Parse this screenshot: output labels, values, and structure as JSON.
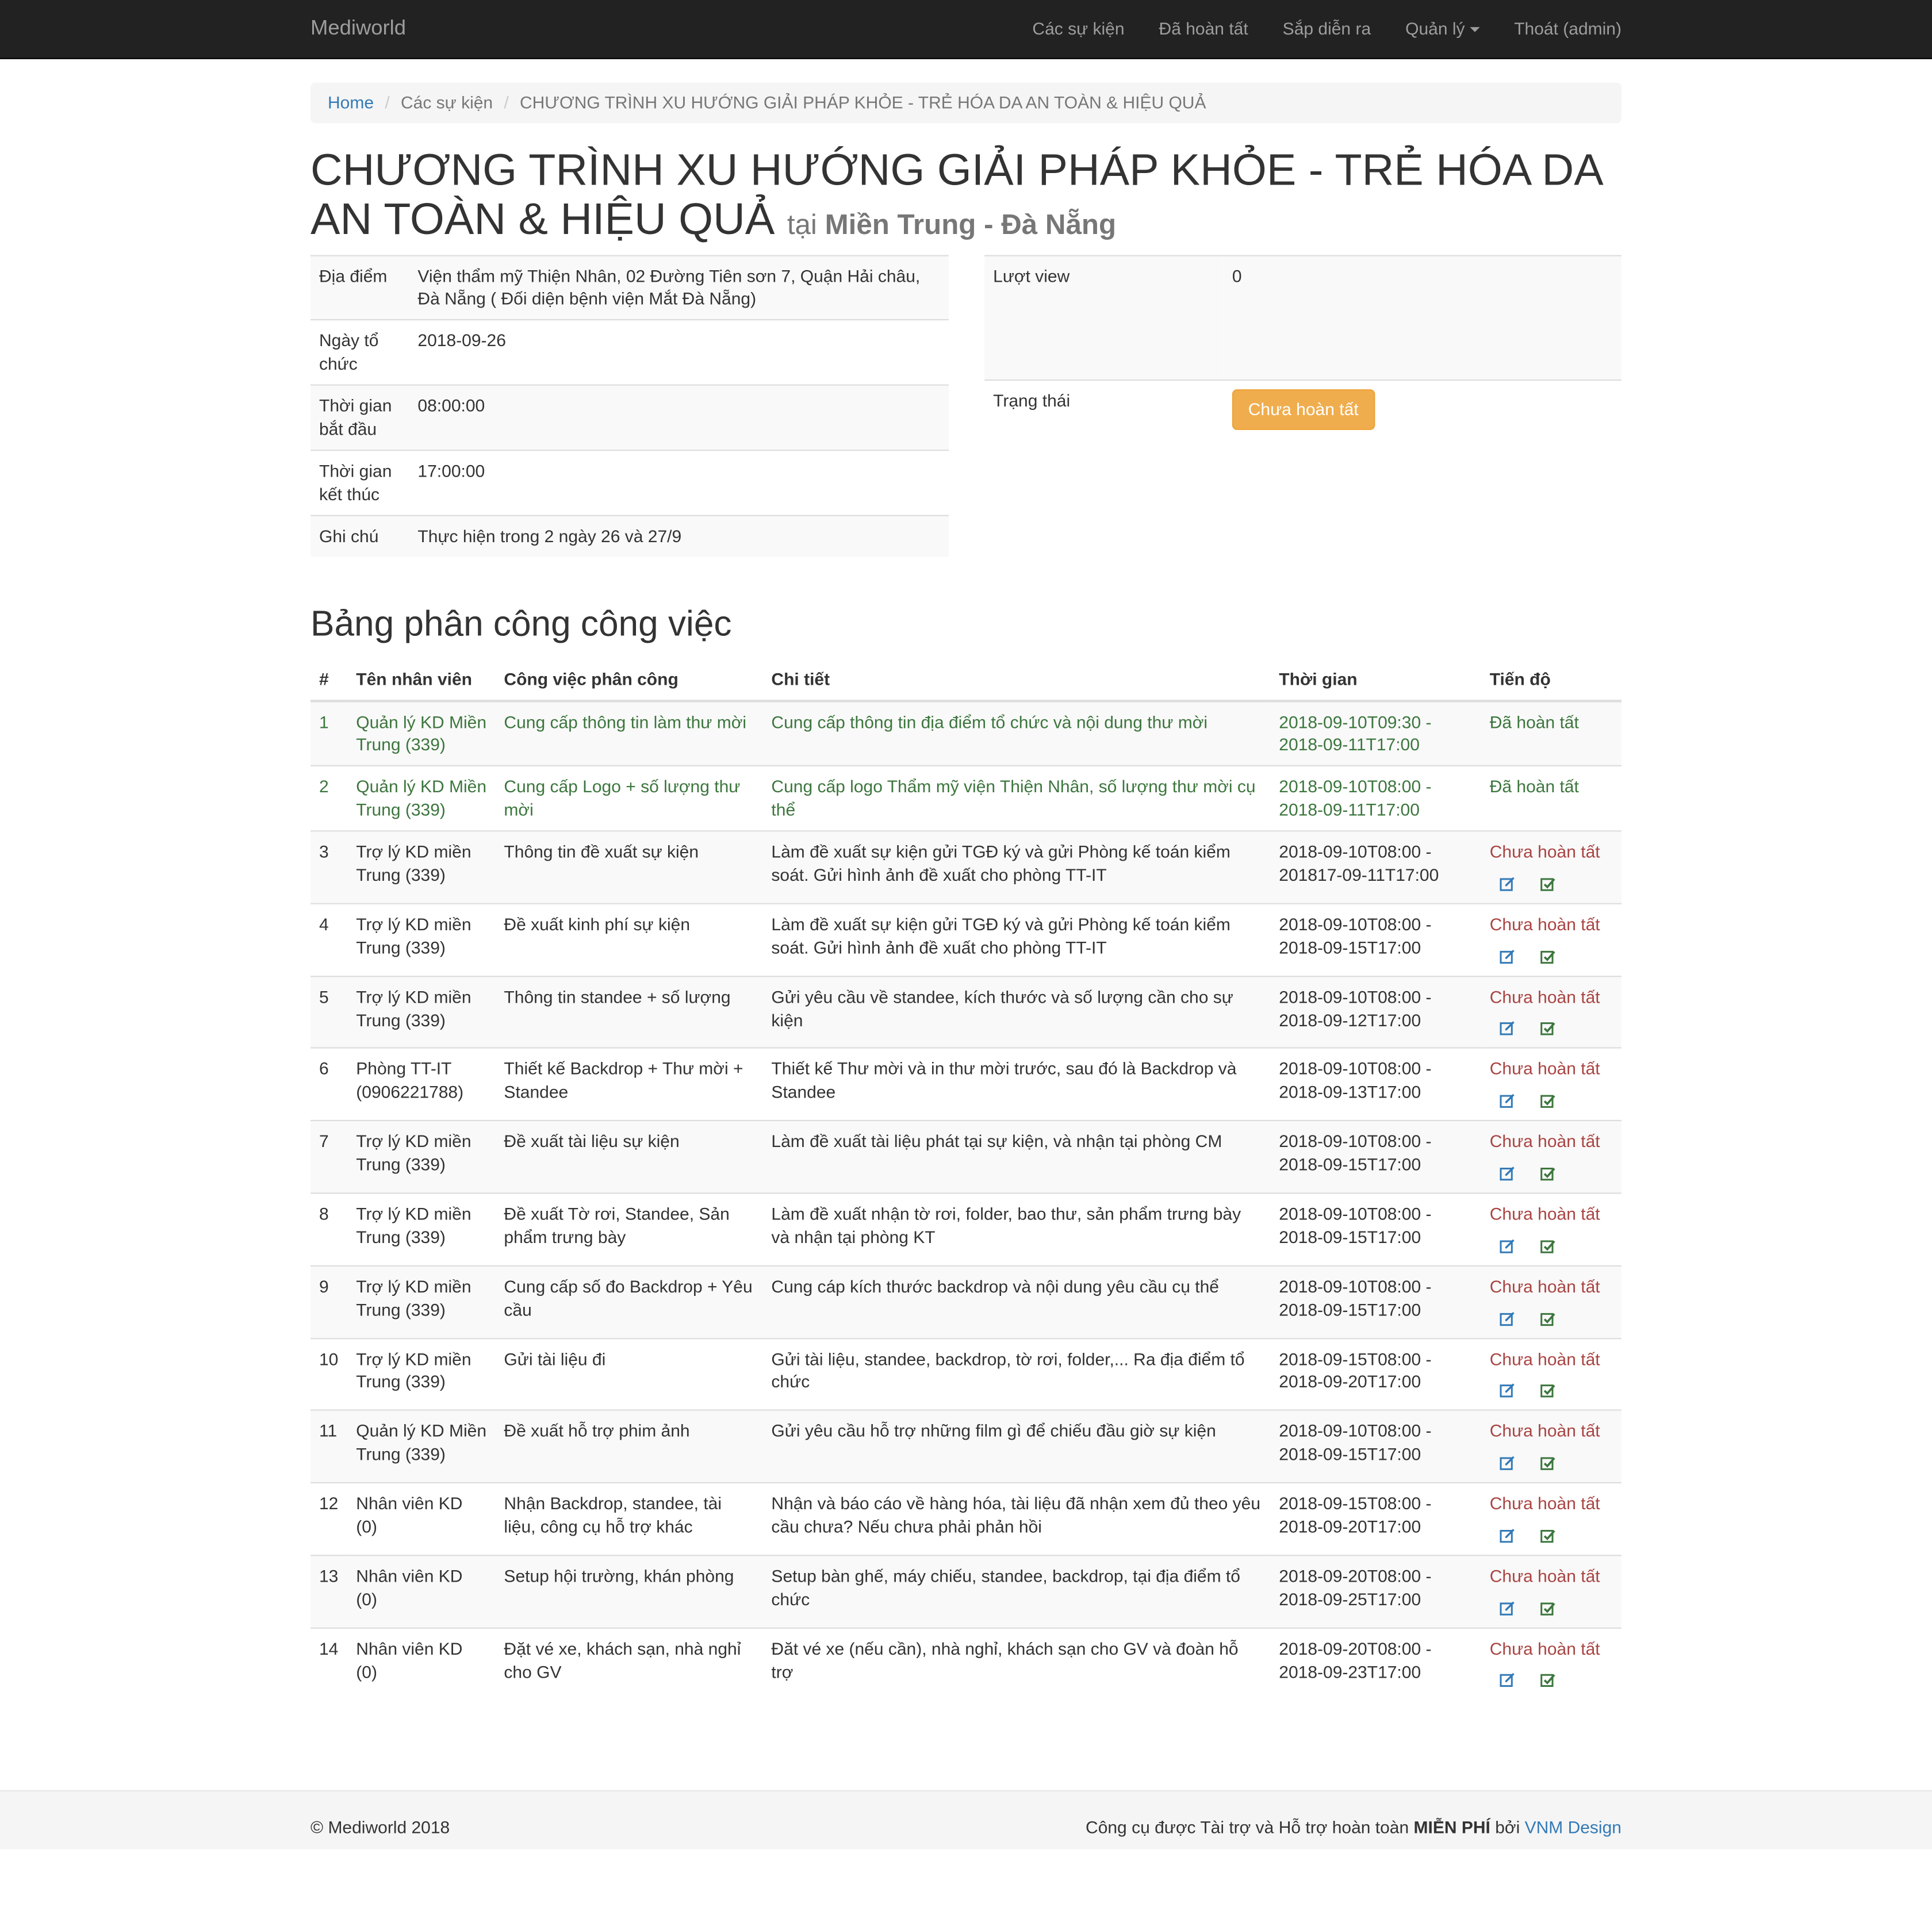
{
  "navbar": {
    "brand": "Mediworld",
    "items": [
      "Các sự kiện",
      "Đã hoàn tất",
      "Sắp diễn ra",
      "Quản lý",
      "Thoát (admin)"
    ]
  },
  "breadcrumb": [
    "Home",
    "Các sự kiện",
    "CHƯƠNG TRÌNH XU HƯỚNG GIẢI PHÁP KHỎE - TRẺ HÓA DA AN TOÀN & HIỆU QUẢ"
  ],
  "event": {
    "title": "CHƯƠNG TRÌNH XU HƯỚNG GIẢI PHÁP KHỎE - TRẺ HÓA DA AN TOÀN & HIỆU QUẢ",
    "at_prefix": "tại",
    "location_region": "Miền Trung - Đà Nẵng",
    "details": [
      {
        "label": "Địa điểm",
        "value": "Viện thẩm mỹ Thiện Nhân, 02 Đường Tiên sơn 7, Quận Hải châu, Đà Nẵng ( Đối diện bệnh viện Mắt Đà Nẵng)"
      },
      {
        "label": "Ngày tổ chức",
        "value": "2018-09-26"
      },
      {
        "label": "Thời gian bắt đầu",
        "value": "08:00:00"
      },
      {
        "label": "Thời gian kết thúc",
        "value": "17:00:00"
      },
      {
        "label": "Ghi chú",
        "value": "Thực hiện trong 2 ngày 26 và 27/9"
      }
    ],
    "views_label": "Lượt view",
    "views": "0",
    "status_label": "Trạng thái",
    "status": "Chưa hoàn tất"
  },
  "tasks": {
    "heading": "Bảng phân công công việc",
    "columns": [
      "#",
      "Tên nhân viên",
      "Công việc phân công",
      "Chi tiết",
      "Thời gian",
      "Tiến độ"
    ],
    "rows": [
      {
        "num": "1",
        "staff": "Quản lý KD Miền Trung (339)",
        "task": "Cung cấp thông tin làm thư mời",
        "detail": "Cung cấp thông tin địa điểm tổ chức và nội dung thư mời",
        "time": "2018-09-10T09:30 - 2018-09-11T17:00",
        "progress": "Đã hoàn tất"
      },
      {
        "num": "2",
        "staff": "Quản lý KD Miền Trung (339)",
        "task": "Cung cấp Logo + số lượng thư mời",
        "detail": "Cung cấp logo Thẩm mỹ viện Thiện Nhân, số lượng thư mời cụ thể",
        "time": "2018-09-10T08:00 - 2018-09-11T17:00",
        "progress": "Đã hoàn tất"
      },
      {
        "num": "3",
        "staff": "Trợ lý KD miền Trung (339)",
        "task": "Thông tin đề xuất sự kiện",
        "detail": "Làm đề xuất sự kiện gửi TGĐ ký và gửi Phòng kế toán kiểm soát. Gửi hình ảnh đề xuất cho phòng TT-IT",
        "time": "2018-09-10T08:00 - 201817-09-11T17:00",
        "progress": "Chưa hoàn tất"
      },
      {
        "num": "4",
        "staff": "Trợ lý KD miền Trung (339)",
        "task": "Đề xuất kinh phí sự kiện",
        "detail": "Làm đề xuất sự kiện gửi TGĐ ký và gửi Phòng kế toán kiểm soát. Gửi hình ảnh đề xuất cho phòng TT-IT",
        "time": "2018-09-10T08:00 - 2018-09-15T17:00",
        "progress": "Chưa hoàn tất"
      },
      {
        "num": "5",
        "staff": "Trợ lý KD miền Trung (339)",
        "task": "Thông tin standee + số lượng",
        "detail": "Gửi yêu cầu về standee, kích thước và số lượng cần cho sự kiện",
        "time": "2018-09-10T08:00 - 2018-09-12T17:00",
        "progress": "Chưa hoàn tất"
      },
      {
        "num": "6",
        "staff": "Phòng TT-IT (0906221788)",
        "task": "Thiết kế Backdrop + Thư mời + Standee",
        "detail": "Thiết kế Thư mời và in thư mời trước, sau đó là Backdrop và Standee",
        "time": "2018-09-10T08:00 - 2018-09-13T17:00",
        "progress": "Chưa hoàn tất"
      },
      {
        "num": "7",
        "staff": "Trợ lý KD miền Trung (339)",
        "task": "Đề xuất tài liệu sự kiện",
        "detail": "Làm đề xuất tài liệu phát tại sự kiện, và nhận tại phòng CM",
        "time": "2018-09-10T08:00 - 2018-09-15T17:00",
        "progress": "Chưa hoàn tất"
      },
      {
        "num": "8",
        "staff": "Trợ lý KD miền Trung (339)",
        "task": "Đề xuất Tờ rơi, Standee, Sản phẩm trưng bày",
        "detail": "Làm đề xuất nhận tờ rơi, folder, bao thư, sản phẩm trưng bày và nhận tại phòng KT",
        "time": "2018-09-10T08:00 - 2018-09-15T17:00",
        "progress": "Chưa hoàn tất"
      },
      {
        "num": "9",
        "staff": "Trợ lý KD miền Trung (339)",
        "task": "Cung cấp số đo Backdrop + Yêu cầu",
        "detail": "Cung cáp kích thước backdrop và nội dung yêu cầu cụ thể",
        "time": "2018-09-10T08:00 - 2018-09-15T17:00",
        "progress": "Chưa hoàn tất"
      },
      {
        "num": "10",
        "staff": "Trợ lý KD miền Trung (339)",
        "task": "Gửi tài liệu đi",
        "detail": "Gửi tài liệu, standee, backdrop, tờ rơi, folder,... Ra địa điểm tổ chức",
        "time": "2018-09-15T08:00 - 2018-09-20T17:00",
        "progress": "Chưa hoàn tất"
      },
      {
        "num": "11",
        "staff": "Quản lý KD Miền Trung (339)",
        "task": "Đề xuất hỗ trợ phim ảnh",
        "detail": "Gửi yêu cầu hỗ trợ những film gì để chiếu đầu giờ sự kiện",
        "time": "2018-09-10T08:00 - 2018-09-15T17:00",
        "progress": "Chưa hoàn tất"
      },
      {
        "num": "12",
        "staff": "Nhân viên KD (0)",
        "task": "Nhận Backdrop, standee, tài liệu, công cụ hỗ trợ khác",
        "detail": "Nhận và báo cáo về hàng hóa, tài liệu đã nhận xem đủ theo yêu cầu chưa? Nếu chưa phải phản hồi",
        "time": "2018-09-15T08:00 - 2018-09-20T17:00",
        "progress": "Chưa hoàn tất"
      },
      {
        "num": "13",
        "staff": "Nhân viên KD (0)",
        "task": "Setup hội trường, khán phòng",
        "detail": "Setup bàn ghế, máy chiếu, standee, backdrop, tại địa điểm tổ chức",
        "time": "2018-09-20T08:00 - 2018-09-25T17:00",
        "progress": "Chưa hoàn tất"
      },
      {
        "num": "14",
        "staff": "Nhân viên KD (0)",
        "task": "Đặt vé xe, khách sạn, nhà nghỉ cho GV",
        "detail": "Đăt vé xe (nếu cần), nhà nghỉ, khách sạn cho GV và đoàn hỗ trợ",
        "time": "2018-09-20T08:00 - 2018-09-23T17:00",
        "progress": "Chưa hoàn tất"
      }
    ]
  },
  "footer": {
    "copyright": "© Mediworld 2018",
    "sponsor_text": "Công cụ được Tài trợ và Hỗ trợ hoàn toàn",
    "free_text": "MIỄN PHÍ",
    "by_text": "bởi",
    "sponsor_link": "VNM Design"
  },
  "colors": {
    "navbar_bg": "#222222",
    "done": "#3c763d",
    "pending": "#a94442",
    "warning": "#f0ad4e",
    "link": "#337ab7"
  }
}
